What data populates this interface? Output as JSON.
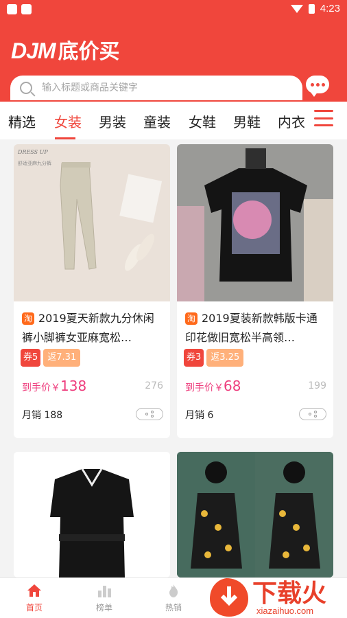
{
  "status_bar": {
    "time": "4:23"
  },
  "header": {
    "logo_latin": "DJM",
    "logo_cn": "底价买",
    "search_placeholder": "输入标题或商品关键字"
  },
  "tabs": [
    "精选",
    "女装",
    "男装",
    "童装",
    "女鞋",
    "男鞋",
    "内衣"
  ],
  "active_tab": "女装",
  "products": [
    {
      "platform": "淘",
      "title": "2019夏天新款九分休闲裤小脚裤女亚麻宽松…",
      "coupon": "券5",
      "rebate": "返7.31",
      "price_label": "到手价￥",
      "price": "138",
      "original_price": "276",
      "monthly_sales": "月销 188"
    },
    {
      "platform": "淘",
      "title": "2019夏装新款韩版卡通印花做旧宽松半高领…",
      "coupon": "券3",
      "rebate": "返3.25",
      "price_label": "到手价￥",
      "price": "68",
      "original_price": "199",
      "monthly_sales": "月销 6"
    }
  ],
  "bottom_nav": [
    {
      "label": "首页",
      "icon": "home-icon"
    },
    {
      "label": "榜单",
      "icon": "chart-icon"
    },
    {
      "label": "热销",
      "icon": "flame-icon"
    }
  ],
  "watermark": {
    "text": "下载火",
    "url": "xiazaihuo.com"
  },
  "colors": {
    "brand": "#f0463c",
    "price": "#ee3d7d",
    "rebate": "#ffb07a"
  }
}
